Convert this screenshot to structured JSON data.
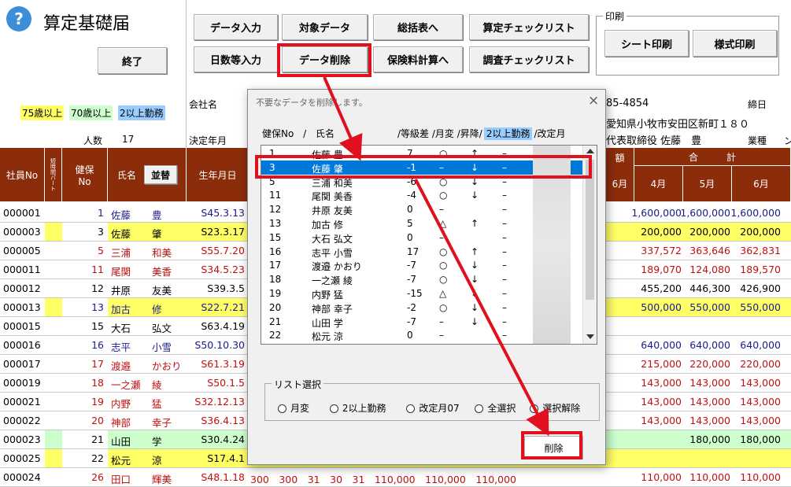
{
  "app": {
    "help_icon": "?",
    "title": "算定基礎届",
    "exit_label": "終了"
  },
  "toolbar": {
    "row1": [
      "データ入力",
      "対象データ",
      "総括表へ",
      "算定チェックリスト"
    ],
    "row2": [
      "日数等入力",
      "データ削除",
      "保険料計算へ",
      "調査チェックリスト"
    ]
  },
  "print": {
    "legend": "印刷",
    "sheet": "シート印刷",
    "form": "様式印刷"
  },
  "legend": {
    "age75": "75歳以上",
    "age70": "70歳以上",
    "multi": "2以上勤務",
    "colors": {
      "age75": "#ffff66",
      "age70": "#ccffcc",
      "multi": "#99ccff"
    }
  },
  "company": {
    "name_label": "会社名",
    "code": "85-4854",
    "address": "愛知県小牧市安田区新町１８０",
    "rep": "代表取締役 佐藤　豊",
    "shime": "締日",
    "gyoshu": "業種",
    "trail": "ン"
  },
  "count": {
    "label": "人数",
    "value": "17"
  },
  "decision_label": "決定年月",
  "headers": {
    "no": "社員No",
    "part": "短時間パート",
    "kenpo": "健保No",
    "name": "氏名",
    "sort": "並替",
    "birth": "生年月日",
    "gaku": "額",
    "total": "合　　　計",
    "m6a": "6月",
    "m4": "4月",
    "m5": "5月",
    "m6": "6月"
  },
  "rows": [
    {
      "no": "000001",
      "k": "1",
      "n1": "佐藤",
      "n2": "豊",
      "b": "S45.3.13",
      "m4": "1,600,000",
      "m5": "1,600,000",
      "m6": "1,600,000",
      "bg": "",
      "c": "#1a1a8c"
    },
    {
      "no": "000003",
      "k": "3",
      "n1": "佐藤",
      "n2": "肇",
      "b": "S23.3.17",
      "m4": "200,000",
      "m5": "200,000",
      "m6": "200,000",
      "bg": "#ffff66",
      "c": "#000"
    },
    {
      "no": "000005",
      "k": "5",
      "n1": "三浦",
      "n2": "和美",
      "b": "S55.7.20",
      "m4": "337,572",
      "m5": "363,646",
      "m6": "362,831",
      "bg": "",
      "c": "#c01010"
    },
    {
      "no": "000011",
      "k": "11",
      "n1": "尾関",
      "n2": "美香",
      "b": "S34.5.23",
      "m4": "189,070",
      "m5": "124,080",
      "m6": "189,570",
      "bg": "",
      "c": "#c01010"
    },
    {
      "no": "000012",
      "k": "12",
      "n1": "井原",
      "n2": "友美",
      "b": "S39.3.5",
      "m4": "455,200",
      "m5": "446,300",
      "m6": "426,900",
      "bg": "",
      "c": "#000"
    },
    {
      "no": "000013",
      "k": "13",
      "n1": "加古",
      "n2": "修",
      "b": "S22.7.21",
      "m4": "500,000",
      "m5": "550,000",
      "m6": "550,000",
      "bg": "#ffff66",
      "c": "#1a1a8c"
    },
    {
      "no": "000015",
      "k": "15",
      "n1": "大石",
      "n2": "弘文",
      "b": "S63.4.19",
      "m4": "",
      "m5": "",
      "m6": "",
      "bg": "",
      "c": "#000"
    },
    {
      "no": "000016",
      "k": "16",
      "n1": "志平",
      "n2": "小雪",
      "b": "S50.10.30",
      "m4": "640,000",
      "m5": "640,000",
      "m6": "640,000",
      "bg": "",
      "c": "#1a1a8c"
    },
    {
      "no": "000017",
      "k": "17",
      "n1": "渡邉",
      "n2": "かおり",
      "b": "S61.3.19",
      "m4": "215,000",
      "m5": "220,000",
      "m6": "220,000",
      "bg": "",
      "c": "#c01010"
    },
    {
      "no": "000019",
      "k": "18",
      "n1": "一之瀬",
      "n2": "綾",
      "b": "S50.1.5",
      "m4": "143,000",
      "m5": "143,000",
      "m6": "143,000",
      "bg": "",
      "c": "#c01010"
    },
    {
      "no": "000021",
      "k": "19",
      "n1": "内野",
      "n2": "猛",
      "b": "S32.12.13",
      "m4": "143,000",
      "m5": "143,000",
      "m6": "143,000",
      "bg": "",
      "c": "#c01010"
    },
    {
      "no": "000022",
      "k": "20",
      "n1": "神部",
      "n2": "幸子",
      "b": "S36.4.13",
      "m4": "143,000",
      "m5": "143,000",
      "m6": "143,000",
      "bg": "",
      "c": "#c01010"
    },
    {
      "no": "000023",
      "k": "21",
      "n1": "山田",
      "n2": "学",
      "b": "S30.4.24",
      "m4": "",
      "m5": "180,000",
      "m6": "180,000",
      "bg": "#ccffcc",
      "c": "#000"
    },
    {
      "no": "000025",
      "k": "22",
      "n1": "松元",
      "n2": "涼",
      "b": "S17.4.1",
      "m4": "",
      "m5": "",
      "m6": "",
      "bg": "#ffff66",
      "c": "#000"
    },
    {
      "no": "000024",
      "k": "26",
      "n1": "田口",
      "n2": "輝美",
      "b": "S48.1.18",
      "m4": "110,000",
      "m5": "110,000",
      "m6": "110,000",
      "bg": "",
      "c": "#c01010",
      "extra": "300　300　31　30　31　110,000　110,000　110,000"
    }
  ],
  "dialog": {
    "title": "不要なデータを削除します。",
    "close": "×",
    "cols": {
      "kenpo": "健保No",
      "sep": "/",
      "name": "氏名",
      "tokyu": "/等級差",
      "getsuhen": "/月変",
      "shoko": "/昇降/",
      "multi": "2以上勤務",
      "kaitei": "/改定月"
    },
    "items": [
      {
        "no": "1",
        "name": "佐藤 豊",
        "d": "7",
        "g": "○",
        "s": "↑",
        "m": "–"
      },
      {
        "no": "3",
        "name": "佐藤 肇",
        "d": "-1",
        "g": "–",
        "s": "↓",
        "m": "–"
      },
      {
        "no": "5",
        "name": "三浦 和美",
        "d": "-6",
        "g": "○",
        "s": "↓",
        "m": "–"
      },
      {
        "no": "11",
        "name": "尾関 美香",
        "d": "-4",
        "g": "○",
        "s": "↓",
        "m": "–"
      },
      {
        "no": "12",
        "name": "井原 友美",
        "d": "0",
        "g": "–",
        "s": "",
        "m": "–"
      },
      {
        "no": "13",
        "name": "加古 修",
        "d": "5",
        "g": "△",
        "s": "↑",
        "m": "–"
      },
      {
        "no": "15",
        "name": "大石 弘文",
        "d": "0",
        "g": "–",
        "s": "",
        "m": "–"
      },
      {
        "no": "16",
        "name": "志平 小雪",
        "d": "17",
        "g": "○",
        "s": "↑",
        "m": "–"
      },
      {
        "no": "17",
        "name": "渡邉 かおり",
        "d": "-7",
        "g": "○",
        "s": "↓",
        "m": "–"
      },
      {
        "no": "18",
        "name": "一之瀬 綾",
        "d": "-7",
        "g": "○",
        "s": "↓",
        "m": "–"
      },
      {
        "no": "19",
        "name": "内野 猛",
        "d": "-15",
        "g": "△",
        "s": "↓",
        "m": "–"
      },
      {
        "no": "20",
        "name": "神部 幸子",
        "d": "-2",
        "g": "○",
        "s": "↓",
        "m": "–"
      },
      {
        "no": "21",
        "name": "山田 学",
        "d": "-7",
        "g": "–",
        "s": "↓",
        "m": "–"
      },
      {
        "no": "22",
        "name": "松元 涼",
        "d": "0",
        "g": "–",
        "s": "",
        "m": "–"
      }
    ],
    "selected_index": 1,
    "list_select": {
      "legend": "リスト選択",
      "options": [
        "月変",
        "2以上勤務",
        "改定月07",
        "全選択",
        "選択解除"
      ]
    },
    "delete_label": "削除"
  },
  "accent": "#8b2c0a",
  "highlight": "#e0101e",
  "select_blue": "#0078d7"
}
